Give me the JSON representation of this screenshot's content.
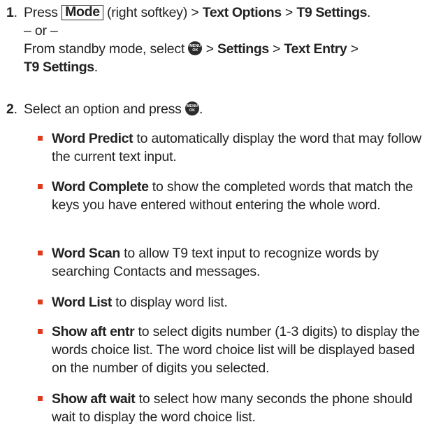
{
  "step1": {
    "number": "1",
    "press": "Press",
    "key_label": "Mode",
    "softkey_note": "(right softkey) >",
    "path_a": "Text Options",
    "sep": ">",
    "path_b": "T9 Settings",
    "period": ".",
    "or_line": "– or –",
    "standby_text": "From standby mode, select",
    "menu_icon_top": "MENU",
    "menu_icon_bottom": "OK",
    "path_c": "Settings",
    "path_d": "Text Entry",
    "path_e": "T9 Settings"
  },
  "step2": {
    "number": "2",
    "text": "Select an option and press",
    "period": "."
  },
  "options": [
    {
      "term": "Word Predict",
      "desc": "to automatically display the word that may follow the current text input."
    },
    {
      "term": "Word Complete",
      "desc": "to show the completed words that match the keys you have entered without entering the whole word."
    },
    {
      "term": "Word Scan",
      "desc": "to allow T9 text input to recognize words by searching Contacts and messages."
    },
    {
      "term": "Word List",
      "desc": "to display word list."
    },
    {
      "term": "Show aft entr",
      "desc": "to select digits number (1-3 digits) to display the words choice list. The word choice list will be displayed based on the number of digits you selected."
    },
    {
      "term": "Show aft wait",
      "desc": "to select how many seconds the phone should wait to display the word choice list."
    }
  ],
  "colors": {
    "bullet": "#e03a1e",
    "text": "#222222",
    "icon": "#2b2b2b"
  }
}
